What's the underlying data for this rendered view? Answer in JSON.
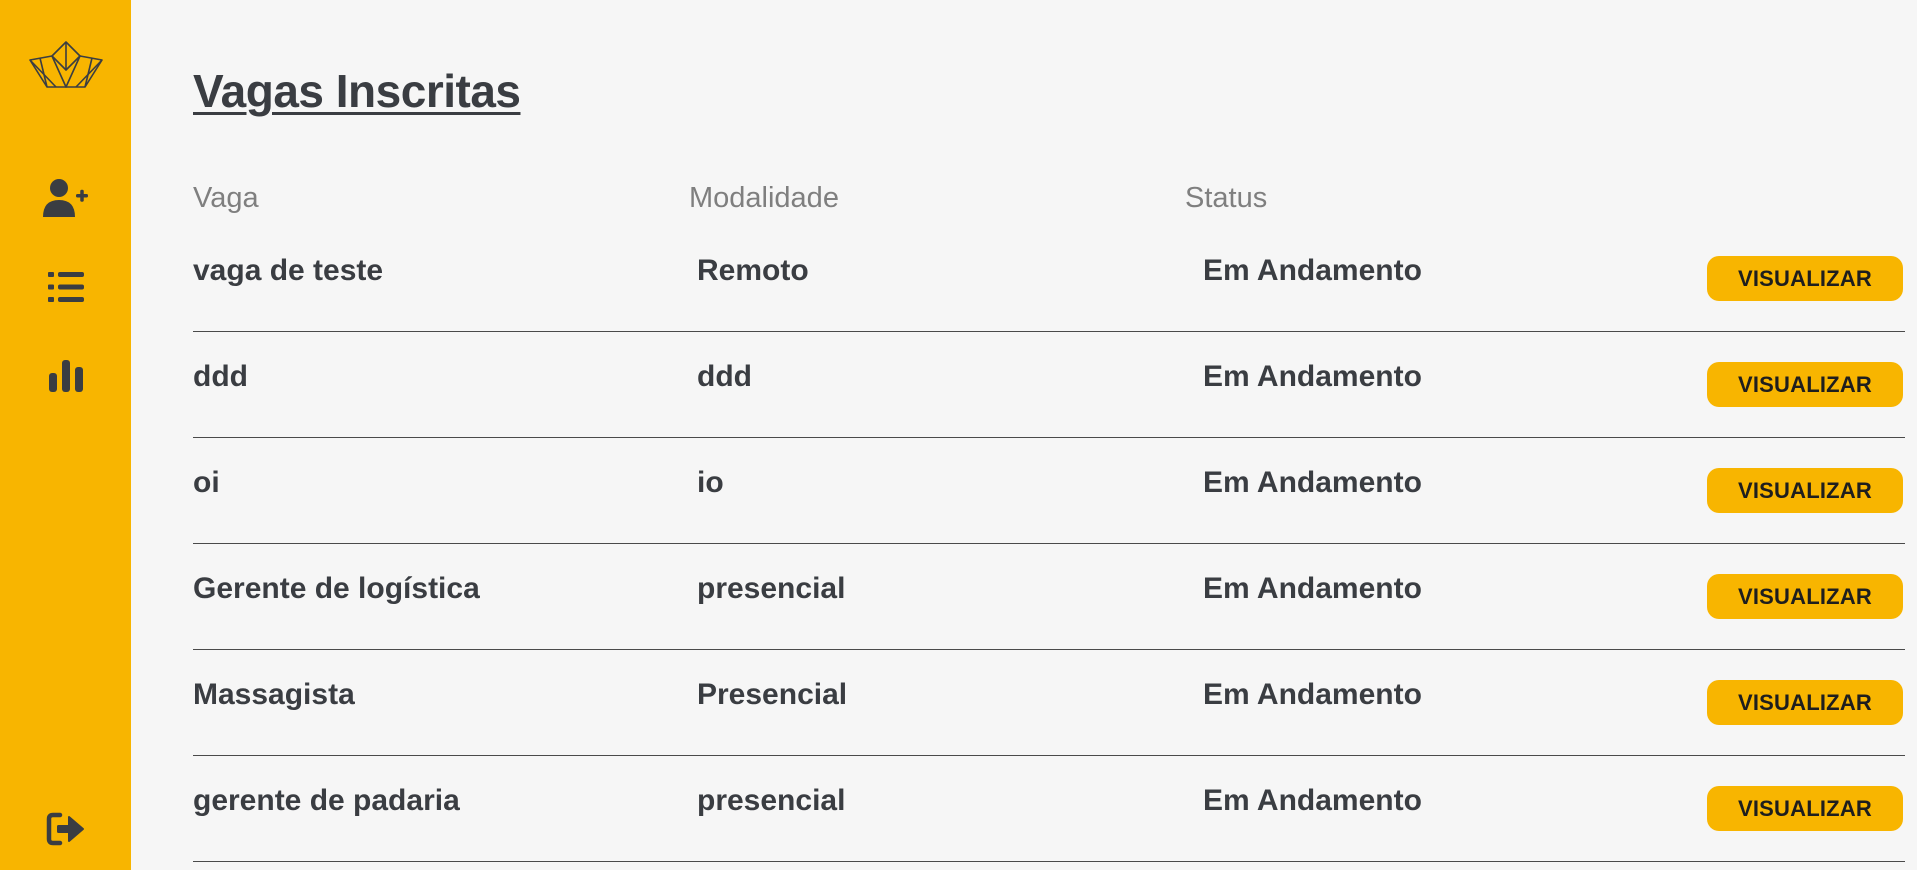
{
  "page": {
    "title": "Vagas Inscritas"
  },
  "colors": {
    "accent": "#f8b500",
    "text": "#3a3d42",
    "header_text": "#7f7f7f",
    "background": "#f6f6f6"
  },
  "sidebar": {
    "logo_icon": "geometric-lotus-logo",
    "items": [
      {
        "icon": "user-plus-icon"
      },
      {
        "icon": "list-icon"
      },
      {
        "icon": "bar-chart-icon"
      }
    ],
    "logout_icon": "sign-out-icon"
  },
  "table": {
    "headers": [
      "Vaga",
      "Modalidade",
      "Status"
    ],
    "rows": [
      {
        "vaga": "vaga de teste",
        "modalidade": "Remoto",
        "status": "Em Andamento",
        "action": "VISUALIZAR"
      },
      {
        "vaga": "ddd",
        "modalidade": "ddd",
        "status": "Em Andamento",
        "action": "VISUALIZAR"
      },
      {
        "vaga": "oi",
        "modalidade": "io",
        "status": "Em Andamento",
        "action": "VISUALIZAR"
      },
      {
        "vaga": "Gerente de logística",
        "modalidade": "presencial",
        "status": "Em Andamento",
        "action": "VISUALIZAR"
      },
      {
        "vaga": "Massagista",
        "modalidade": "Presencial",
        "status": "Em Andamento",
        "action": "VISUALIZAR"
      },
      {
        "vaga": "gerente de padaria",
        "modalidade": "presencial",
        "status": "Em Andamento",
        "action": "VISUALIZAR"
      }
    ]
  }
}
